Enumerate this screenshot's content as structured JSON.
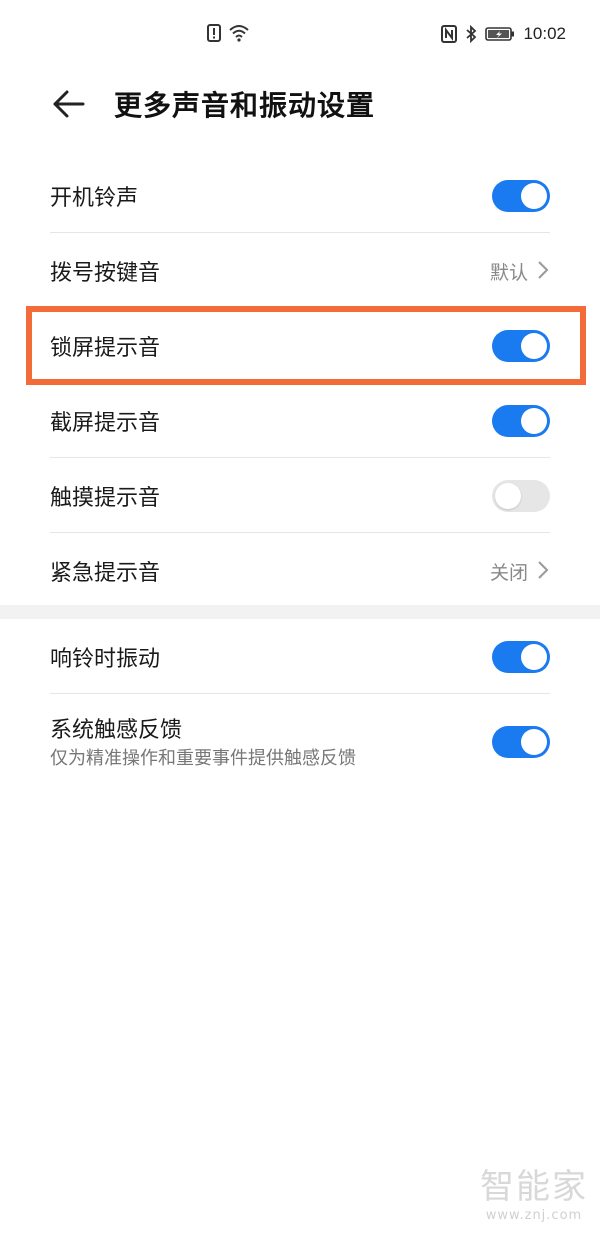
{
  "status_bar": {
    "time": "10:02",
    "icons": [
      "alert-icon",
      "wifi-icon",
      "nfc-icon",
      "bluetooth-icon",
      "battery-icon"
    ]
  },
  "header": {
    "back_icon": "back-arrow-icon",
    "title": "更多声音和振动设置"
  },
  "section1": {
    "items": [
      {
        "label": "开机铃声",
        "type": "toggle",
        "on": true
      },
      {
        "label": "拨号按键音",
        "type": "link",
        "value": "默认"
      },
      {
        "label": "锁屏提示音",
        "type": "toggle",
        "on": true
      },
      {
        "label": "截屏提示音",
        "type": "toggle",
        "on": true
      },
      {
        "label": "触摸提示音",
        "type": "toggle",
        "on": false
      },
      {
        "label": "紧急提示音",
        "type": "link",
        "value": "关闭"
      }
    ]
  },
  "section2": {
    "items": [
      {
        "label": "响铃时振动",
        "type": "toggle",
        "on": true
      },
      {
        "label": "系统触感反馈",
        "sublabel": "仅为精准操作和重要事件提供触感反馈",
        "type": "toggle",
        "on": true
      }
    ]
  },
  "highlight_color": "#f26b38",
  "accent_color": "#1a7af0",
  "watermark": {
    "logo": "智能家",
    "url": "www.znj.com"
  }
}
